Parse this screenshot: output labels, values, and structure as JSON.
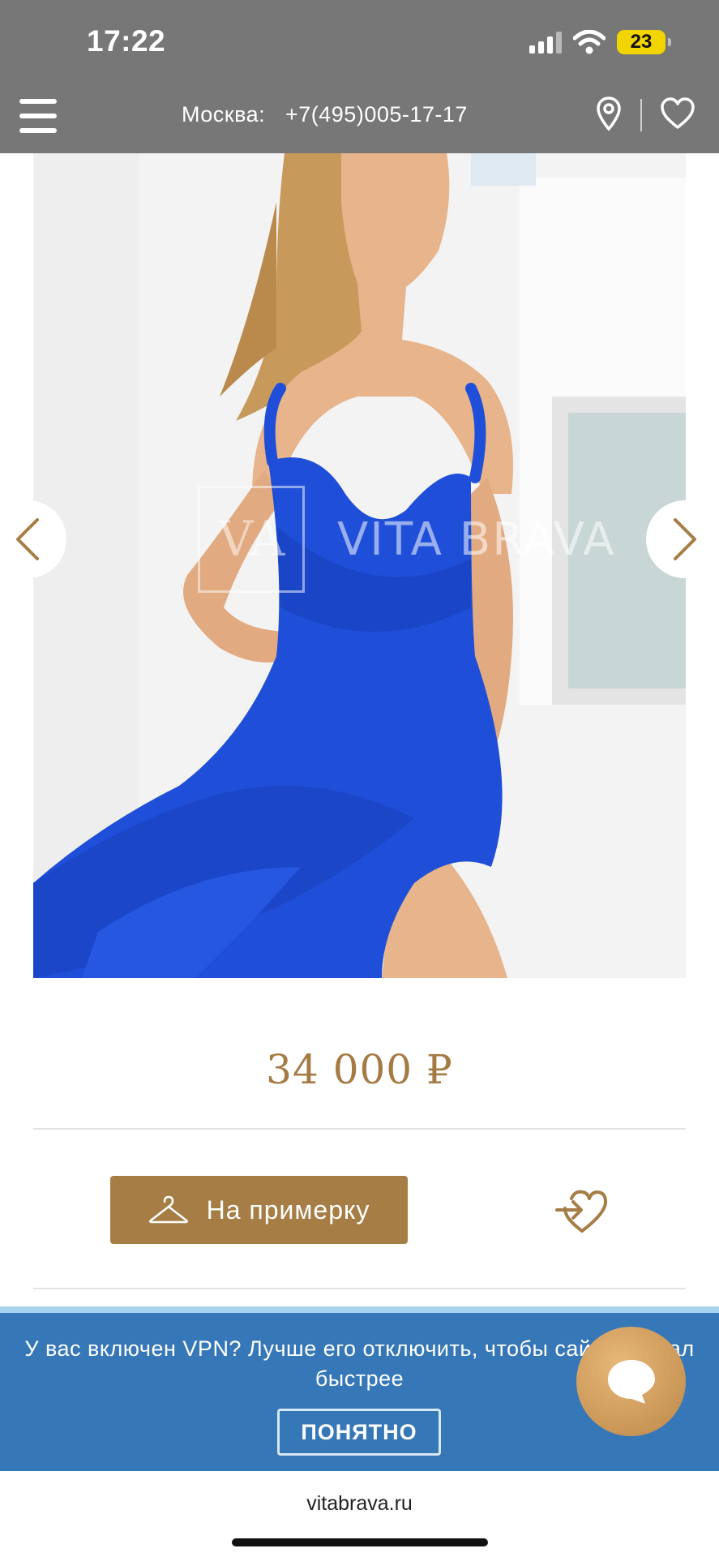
{
  "status_bar": {
    "time": "17:22",
    "battery": "23",
    "battery_color": "#f2d500",
    "icons": [
      "signal-icon",
      "wifi-icon",
      "battery-icon"
    ]
  },
  "header": {
    "city": "Москва:",
    "phone": "+7(495)005-17-17",
    "icons": [
      "menu-icon",
      "location-pin-icon",
      "heart-icon"
    ]
  },
  "product": {
    "watermark_mark": "VA",
    "watermark_text": "VITA BRAVA",
    "price": "34 000 ₽",
    "fit_button_label": "На примерку",
    "accent_color": "#a57d45"
  },
  "vpn_banner": {
    "message": "У вас включен VPN? Лучше его отключить, чтобы сайт работал быстрее",
    "button_label": "ПОНЯТНО",
    "background_color": "#3677b8"
  },
  "browser": {
    "url": "vitabrava.ru"
  }
}
